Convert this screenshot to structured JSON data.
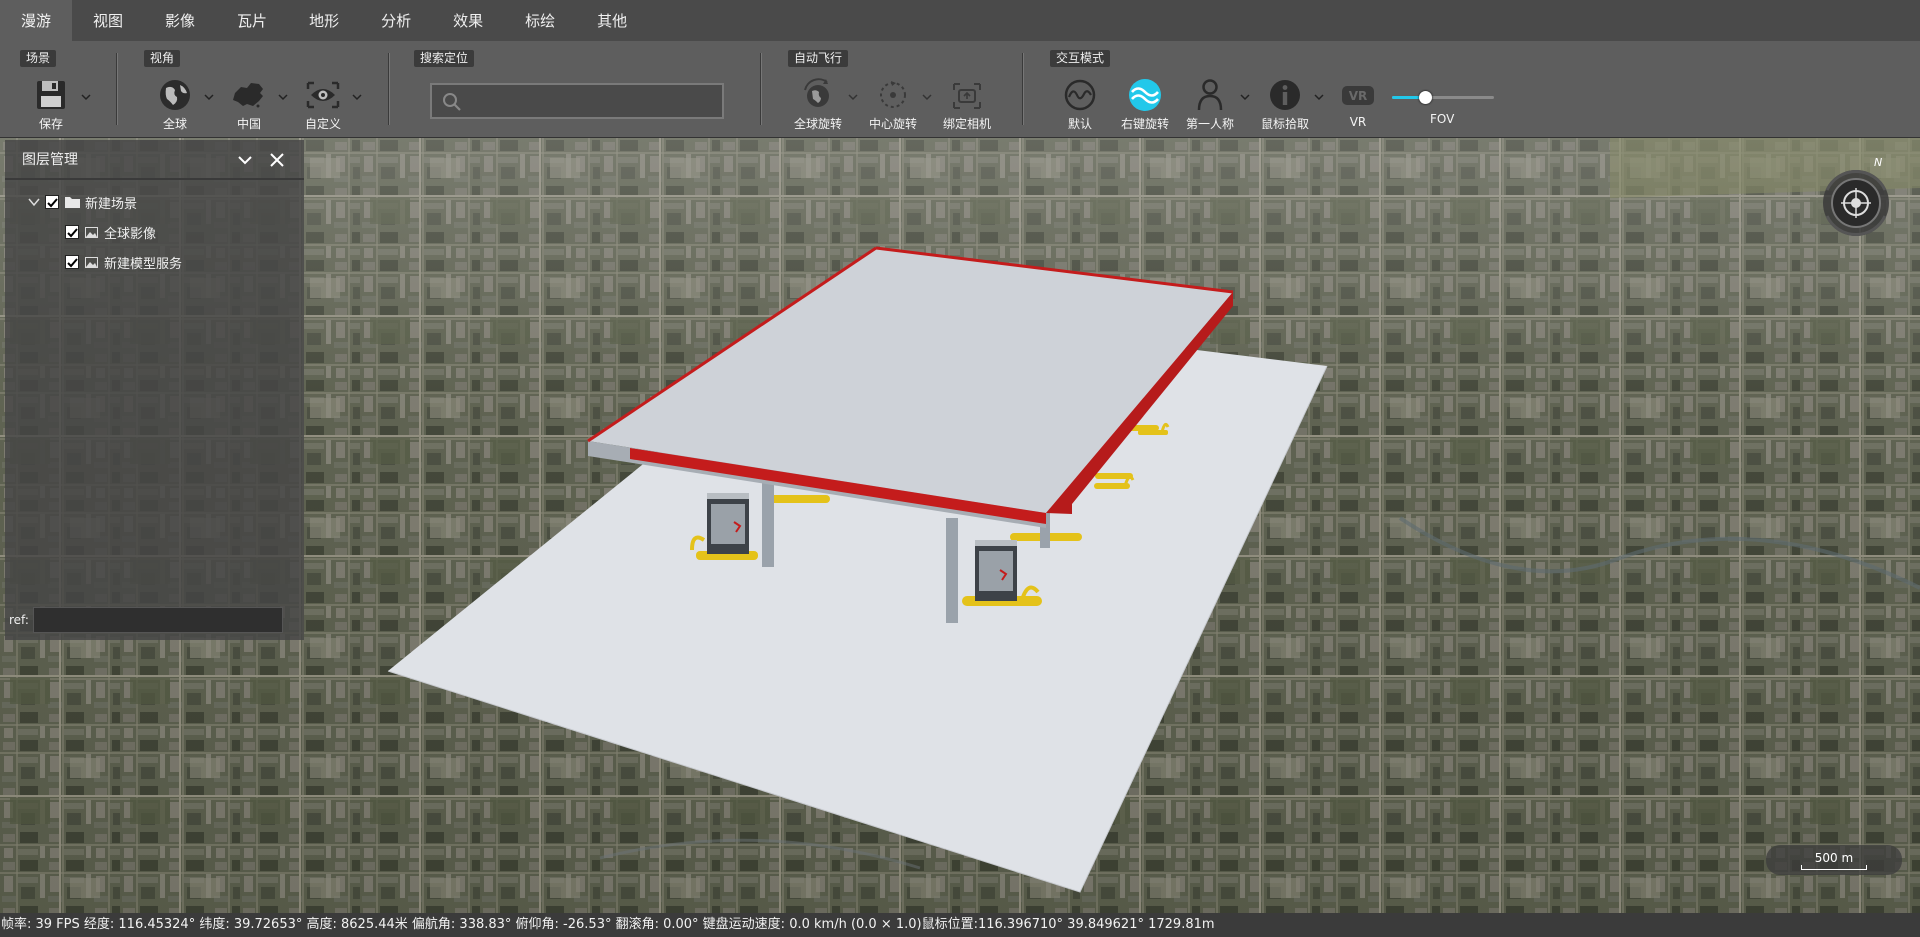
{
  "menu": {
    "tabs": [
      {
        "label": "漫游"
      },
      {
        "label": "视图"
      },
      {
        "label": "影像"
      },
      {
        "label": "瓦片"
      },
      {
        "label": "地形"
      },
      {
        "label": "分析"
      },
      {
        "label": "效果"
      },
      {
        "label": "标绘"
      },
      {
        "label": "其他"
      }
    ],
    "active_index": 0
  },
  "ribbon": {
    "groups": {
      "scene": "场景",
      "view": "视角",
      "search": "搜索定位",
      "autoflight": "自动飞行",
      "interaction": "交互模式"
    },
    "tools": {
      "save": "保存",
      "globe": "全球",
      "china": "中国",
      "custom": "自定义",
      "globe_rotate": "全球旋转",
      "center_rotate": "中心旋转",
      "bind_camera": "绑定相机",
      "default": "默认",
      "right_rotate": "右键旋转",
      "first_person": "第一人称",
      "mouse_pick": "鼠标拾取",
      "vr": "VR"
    },
    "search": {
      "value": "",
      "placeholder": ""
    },
    "fov": {
      "label": "FOV",
      "value": 0.32
    },
    "accent_color": "#22c8ea"
  },
  "layer_panel": {
    "title": "图层管理",
    "tree": {
      "root": {
        "label": "新建场景",
        "checked": true
      },
      "children": [
        {
          "label": "全球影像",
          "checked": true
        },
        {
          "label": "新建模型服务",
          "checked": true
        }
      ]
    },
    "ref_label": "ref:",
    "ref_value": ""
  },
  "compass": {
    "north_label": "N"
  },
  "scale": {
    "label": "500 m"
  },
  "status": {
    "text": "帧率: 39 FPS 经度: 116.45324° 纬度: 39.72653° 高度: 8625.44米 偏航角: 338.83° 俯仰角: -26.53° 翻滚角: 0.00° 键盘运动速度: 0.0 km/h (0.0 × 1.0)鼠标位置:116.396710° 39.849621° 1729.81m"
  }
}
